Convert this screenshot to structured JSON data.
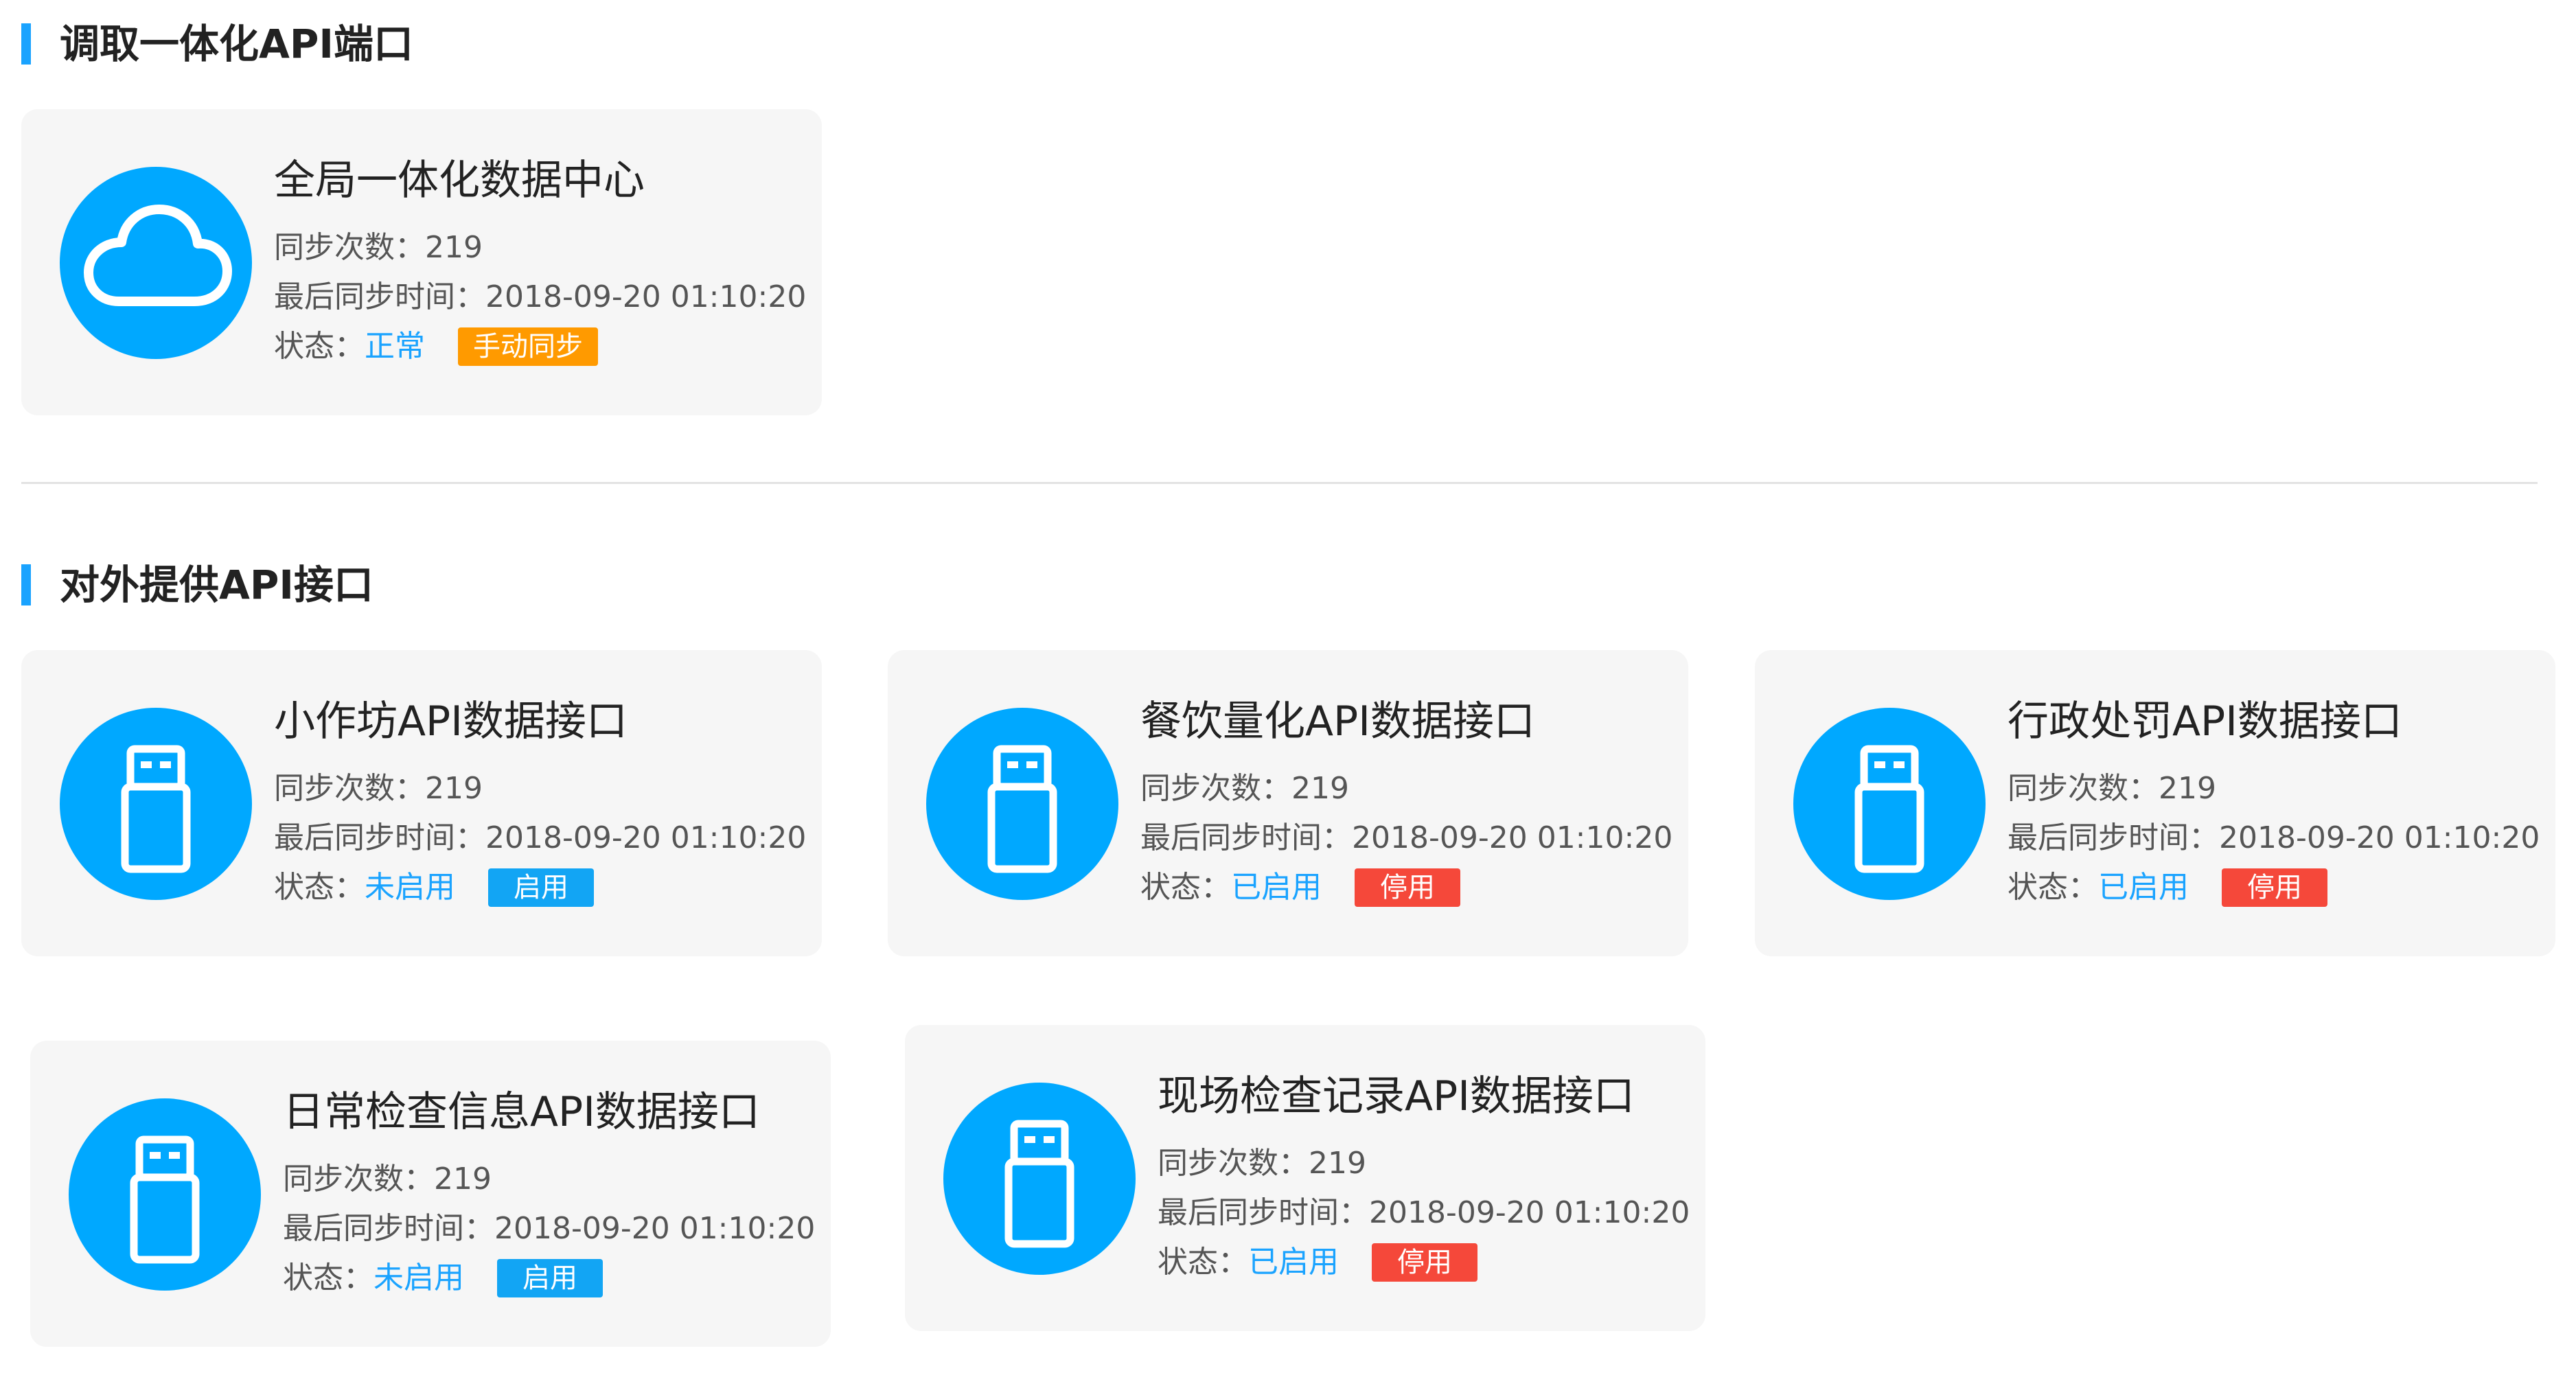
{
  "sections": [
    {
      "title": "调取一体化API端口"
    },
    {
      "title": "对外提供API接口"
    }
  ],
  "labels": {
    "count": "同步次数：",
    "time": "最后同步时间：",
    "status": "状态："
  },
  "icons": {
    "cloud": "cloud-icon",
    "usb": "usb-drive-icon"
  },
  "colors": {
    "accent": "#1aa3ff",
    "icon_circle": "#00a8ff",
    "tag_orange": "#ff9a00",
    "tag_blue": "#12a5f4",
    "tag_red": "#f5483a"
  },
  "cards": [
    {
      "title": "全局一体化数据中心",
      "count": "219",
      "time": "2018-09-20 01:10:20",
      "status": "正常",
      "action": "手动同步"
    },
    {
      "title": "小作坊API数据接口",
      "count": "219",
      "time": "2018-09-20 01:10:20",
      "status": "未启用",
      "action": "启用"
    },
    {
      "title": "餐饮量化API数据接口",
      "count": "219",
      "time": "2018-09-20 01:10:20",
      "status": "已启用",
      "action": "停用"
    },
    {
      "title": "行政处罚API数据接口",
      "count": "219",
      "time": "2018-09-20 01:10:20",
      "status": "已启用",
      "action": "停用"
    },
    {
      "title": "日常检查信息API数据接口",
      "count": "219",
      "time": "2018-09-20 01:10:20",
      "status": "未启用",
      "action": "启用"
    },
    {
      "title": "现场检查记录API数据接口",
      "count": "219",
      "time": "2018-09-20 01:10:20",
      "status": "已启用",
      "action": "停用"
    }
  ]
}
